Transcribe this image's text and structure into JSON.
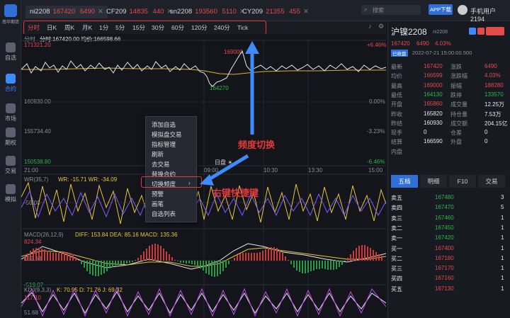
{
  "sidebar": {
    "items": [
      {
        "label": "自选"
      },
      {
        "label": "合约"
      },
      {
        "label": "市场"
      },
      {
        "label": "期权"
      },
      {
        "label": "交易"
      },
      {
        "label": "模拟"
      }
    ],
    "logo_text": "南华期货"
  },
  "tabs": [
    {
      "code": "ni2208",
      "price": "167420",
      "change": "6490"
    },
    {
      "code": "CF209",
      "price": "14835",
      "change": "440"
    },
    {
      "code": "sn2208",
      "price": "193560",
      "change": "5110"
    },
    {
      "code": "CY209",
      "price": "21355",
      "change": "455"
    }
  ],
  "header": {
    "search_placeholder": "搜索",
    "app_download": "APP下载",
    "user": "手机用户2194"
  },
  "periods": [
    "分时",
    "日K",
    "周K",
    "月K",
    "1分",
    "5分",
    "15分",
    "30分",
    "60分",
    "120分",
    "240分",
    "Tick"
  ],
  "chart": {
    "header_label": "分时",
    "header_info": "分时:167420.00  均价:166598.66",
    "price_labels": [
      "171321.20",
      "160930.00",
      "155734.40",
      "150538.80"
    ],
    "pct_labels": [
      "+6.46%",
      "0.00%",
      "-3.23%",
      "-6.46%"
    ],
    "time_labels": [
      "21:00",
      "09:00",
      "10:30",
      "13:30",
      "15:00"
    ],
    "max_marker": "169000",
    "min_marker": "164270",
    "day_marker": "日盘 ☀",
    "wr_header": "WR(35,7)",
    "wr_vals": "WR: -15.71   WR: -34.09",
    "wr_levels": [
      "-50.00"
    ],
    "macd_header": "MACD(26,12,9)",
    "macd_vals": "DIFF: 153.84   DEA: 85.16   MACD: 135.36",
    "macd_levels": [
      "824.34",
      "152.63",
      "-519.07"
    ],
    "kdj_header": "KDJ(9,3,3)",
    "kdj_vals": "K: 70.95   D: 71.76   J: 69.32",
    "kdj_levels": [
      "117.10",
      "51.68"
    ]
  },
  "context_menu": {
    "items": [
      "添加自选",
      "模拟盘交易",
      "指标管理",
      "刷新",
      "去交易",
      "替换合约",
      "切换频度",
      "预警",
      "画笔",
      "自选列表"
    ]
  },
  "annotations": {
    "freq_switch": "频度切换",
    "right_click": "右键快捷键"
  },
  "quote": {
    "name": "沪镍2208",
    "code": "ni2208",
    "price": "167420",
    "change": "6490",
    "pct": "4.03%",
    "status": "已收盘",
    "datetime": "2022-07-21 15:00:00.500",
    "rows": [
      {
        "l1": "最新",
        "v1": "167420",
        "l2": "涨跌",
        "v2": "6490",
        "c1": "red",
        "c2": "red"
      },
      {
        "l1": "均价",
        "v1": "166599",
        "l2": "涨跌幅",
        "v2": "4.03%",
        "c1": "red",
        "c2": "red"
      },
      {
        "l1": "最高",
        "v1": "169000",
        "l2": "振幅",
        "v2": "188280",
        "c1": "red",
        "c2": "red"
      },
      {
        "l1": "最低",
        "v1": "164130",
        "l2": "跌停",
        "v2": "133570",
        "c1": "green",
        "c2": "green"
      },
      {
        "l1": "开盘",
        "v1": "165860",
        "l2": "成交量",
        "v2": "12.25万",
        "c1": "red",
        "c2": "white"
      },
      {
        "l1": "昨收",
        "v1": "165820",
        "l2": "持仓量",
        "v2": "7.53万",
        "c1": "white",
        "c2": "white"
      },
      {
        "l1": "昨结",
        "v1": "160930",
        "l2": "成交额",
        "v2": "204.15亿",
        "c1": "white",
        "c2": "white"
      },
      {
        "l1": "现手",
        "v1": "0",
        "l2": "仓差",
        "v2": "0",
        "c1": "white",
        "c2": "white"
      },
      {
        "l1": "结算",
        "v1": "166590",
        "l2": "外盘",
        "v2": "0",
        "c1": "white",
        "c2": "white"
      },
      {
        "l1": "内盘",
        "v1": "",
        "l2": "",
        "v2": "",
        "c1": "white",
        "c2": "white"
      }
    ],
    "buttons": [
      "五档",
      "明细",
      "F10",
      "交易"
    ],
    "book": [
      {
        "label": "卖五",
        "price": "167480",
        "vol": "3"
      },
      {
        "label": "卖四",
        "price": "167470",
        "vol": "5"
      },
      {
        "label": "卖三",
        "price": "167460",
        "vol": "1"
      },
      {
        "label": "卖二",
        "price": "167450",
        "vol": "1"
      },
      {
        "label": "卖一",
        "price": "167420",
        "vol": "1"
      },
      {
        "label": "买一",
        "price": "167400",
        "vol": "1"
      },
      {
        "label": "买二",
        "price": "167180",
        "vol": "1"
      },
      {
        "label": "买三",
        "price": "167170",
        "vol": "1"
      },
      {
        "label": "买四",
        "price": "167160",
        "vol": "1"
      },
      {
        "label": "买五",
        "price": "167130",
        "vol": "1"
      }
    ]
  },
  "colors": {
    "up": "#e34b4b",
    "down": "#2bb84a",
    "accent": "#3d8bff",
    "bg": "#15171d"
  }
}
